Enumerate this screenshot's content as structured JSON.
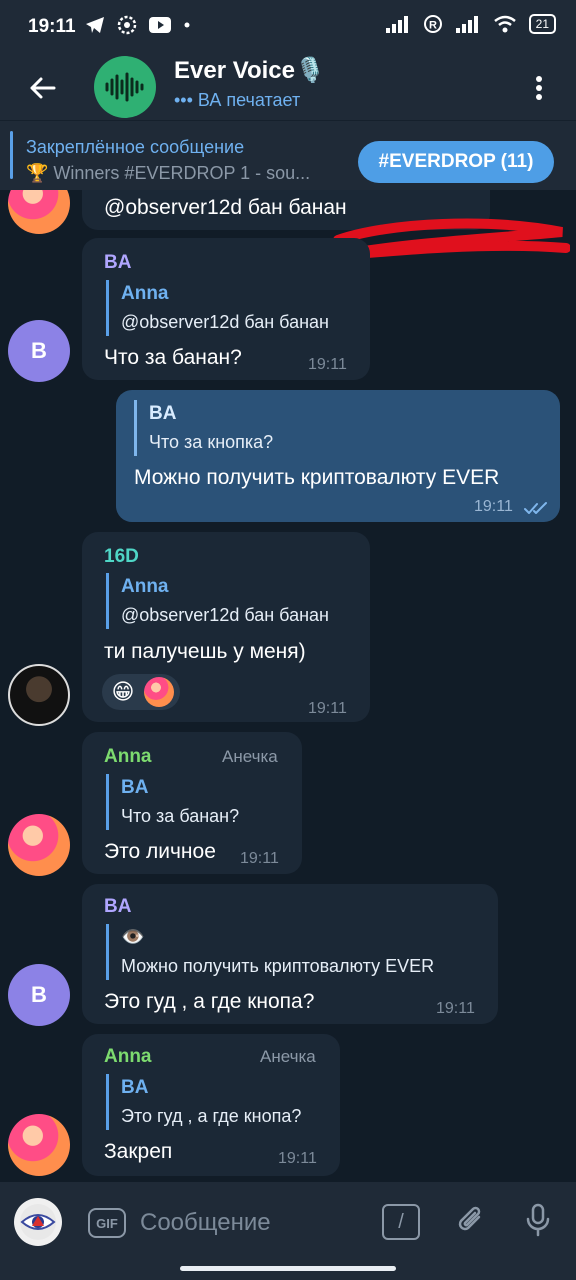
{
  "status_bar": {
    "time": "19:11",
    "battery": "21",
    "icons_left": [
      "telegram-icon",
      "settings-icon",
      "youtube-icon",
      "dot-icon"
    ],
    "icons_right": [
      "signal-icon",
      "registered-icon",
      "signal-icon-2",
      "wifi-icon",
      "battery-icon"
    ]
  },
  "header": {
    "title": "Ever Voice🎙️",
    "status": "••• ВА печатает"
  },
  "pinned": {
    "title": "Закреплённое сообщение",
    "text": "🏆 Winners #EVERDROP  1 - sou...",
    "button": "#EVERDROP (11)"
  },
  "messages": [
    {
      "id": "m0",
      "text": "@observer12d бан банан"
    },
    {
      "id": "m1",
      "avatar_letter": "B",
      "sender": "BA",
      "reply_name": "Anna",
      "reply_text": "@observer12d бан банан",
      "text": "Что за банан?",
      "time": "19:11"
    },
    {
      "id": "m2",
      "outgoing": true,
      "reply_name": "BA",
      "reply_text": "Что за кнопка?",
      "text": "Можно получить криптовалюту EVER",
      "time": "19:11"
    },
    {
      "id": "m3",
      "sender": "16D",
      "reply_name": "Anna",
      "reply_text": "@observer12d бан банан",
      "text": "ти палучешь у меня)",
      "reaction": "😁",
      "time": "19:11"
    },
    {
      "id": "m4",
      "sender": "Anna",
      "title": "Анечка",
      "reply_name": "BA",
      "reply_text": "Что за банан?",
      "text": "Это личное",
      "time": "19:11"
    },
    {
      "id": "m5",
      "avatar_letter": "B",
      "sender": "BA",
      "reply_name": "👁️",
      "reply_text": "Можно получить криптовалюту EVER",
      "text": "Это гуд , а где кнопа?",
      "time": "19:11"
    },
    {
      "id": "m6",
      "sender": "Anna",
      "title": "Анечка",
      "reply_name": "BA",
      "reply_text": "Это гуд , а где кнопа?",
      "text": "Закреп",
      "time": "19:11"
    }
  ],
  "input": {
    "placeholder": "Сообщение",
    "gif_label": "GIF",
    "cmd_label": "/"
  },
  "colors": {
    "background": "#0e1621",
    "bar": "#1f2a37",
    "incoming_bubble": "#1b2836",
    "outgoing_bubble": "#2b5278",
    "accent": "#4e9ee6",
    "ba_name": "#b0a6ff",
    "anna_name": "#7ddb6f",
    "d16_name": "#4fd6c6",
    "scribble": "#e0101d"
  }
}
